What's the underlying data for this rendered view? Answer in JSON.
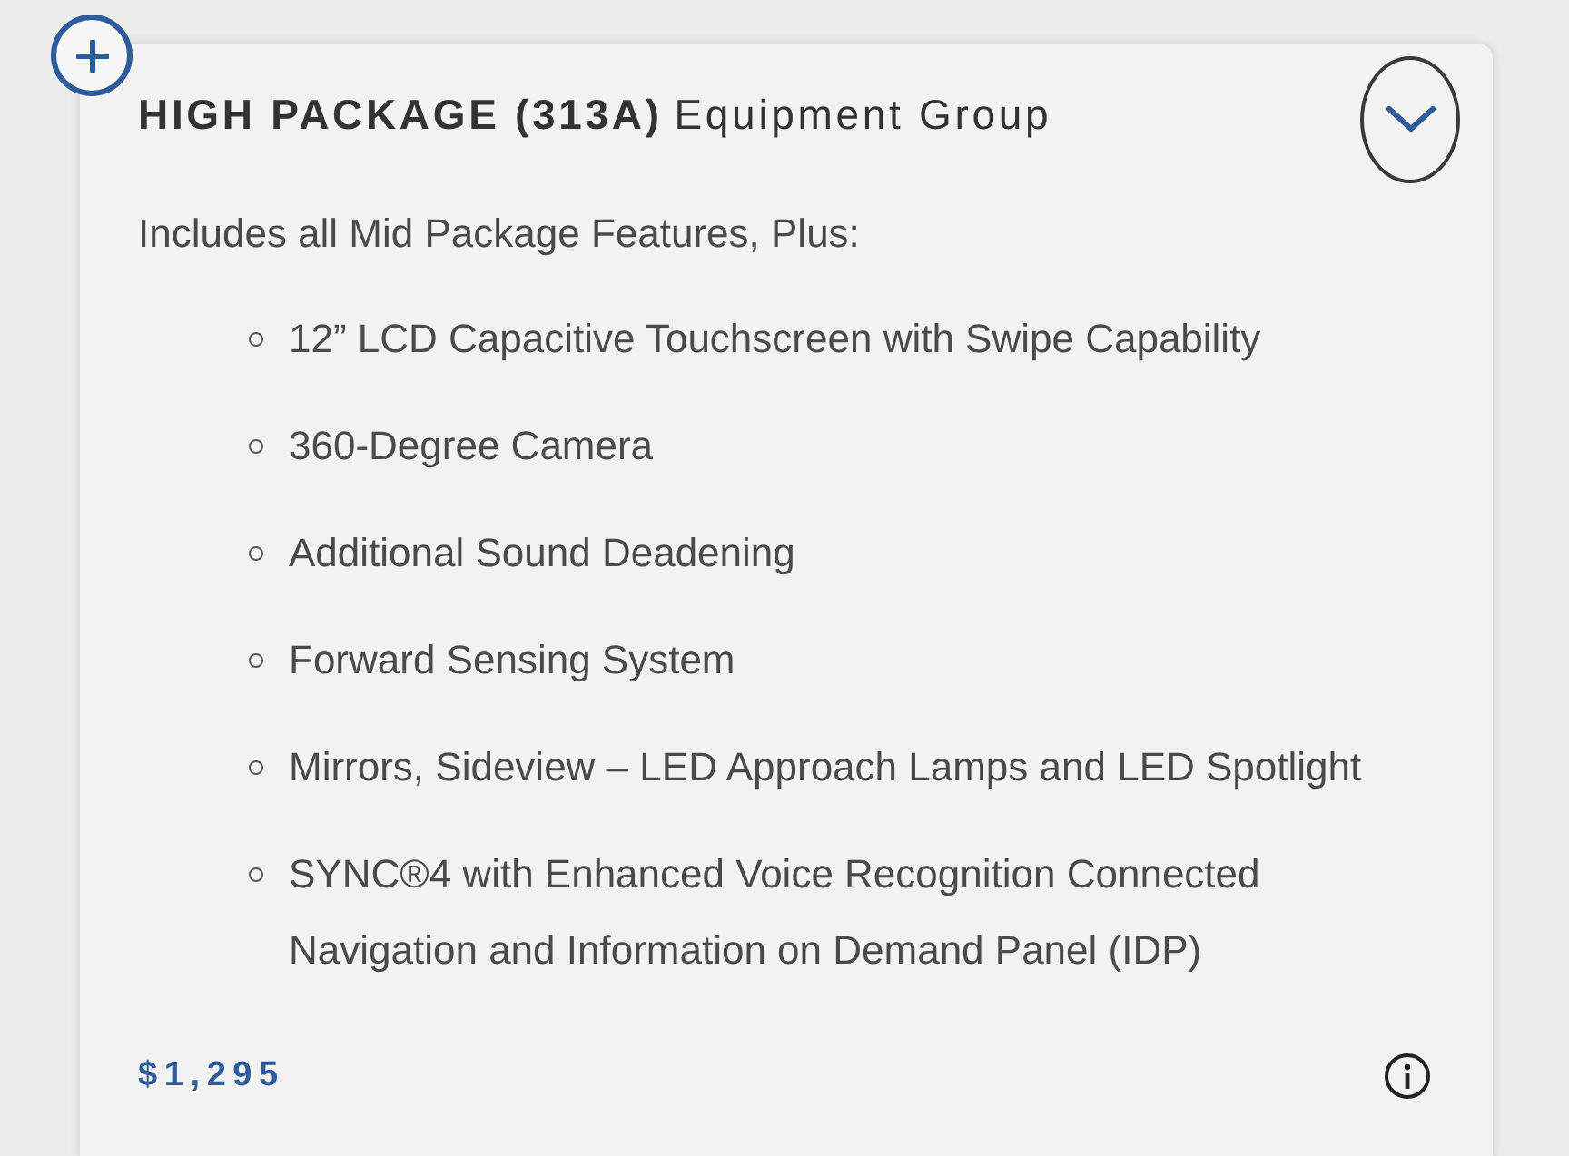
{
  "package": {
    "name": "HIGH PACKAGE (313A)",
    "group": "Equipment Group"
  },
  "intro": "Includes all Mid Package Features, Plus:",
  "features": [
    "12” LCD Capacitive Touchscreen with Swipe Capability",
    "360-Degree Camera",
    "Additional Sound Deadening",
    "Forward Sensing System",
    "Mirrors, Sideview – LED Approach Lamps and LED Spotlight",
    "SYNC®4 with Enhanced Voice Recognition Connected Navigation and Information on Demand Panel (IDP)"
  ],
  "price": "$1,295"
}
